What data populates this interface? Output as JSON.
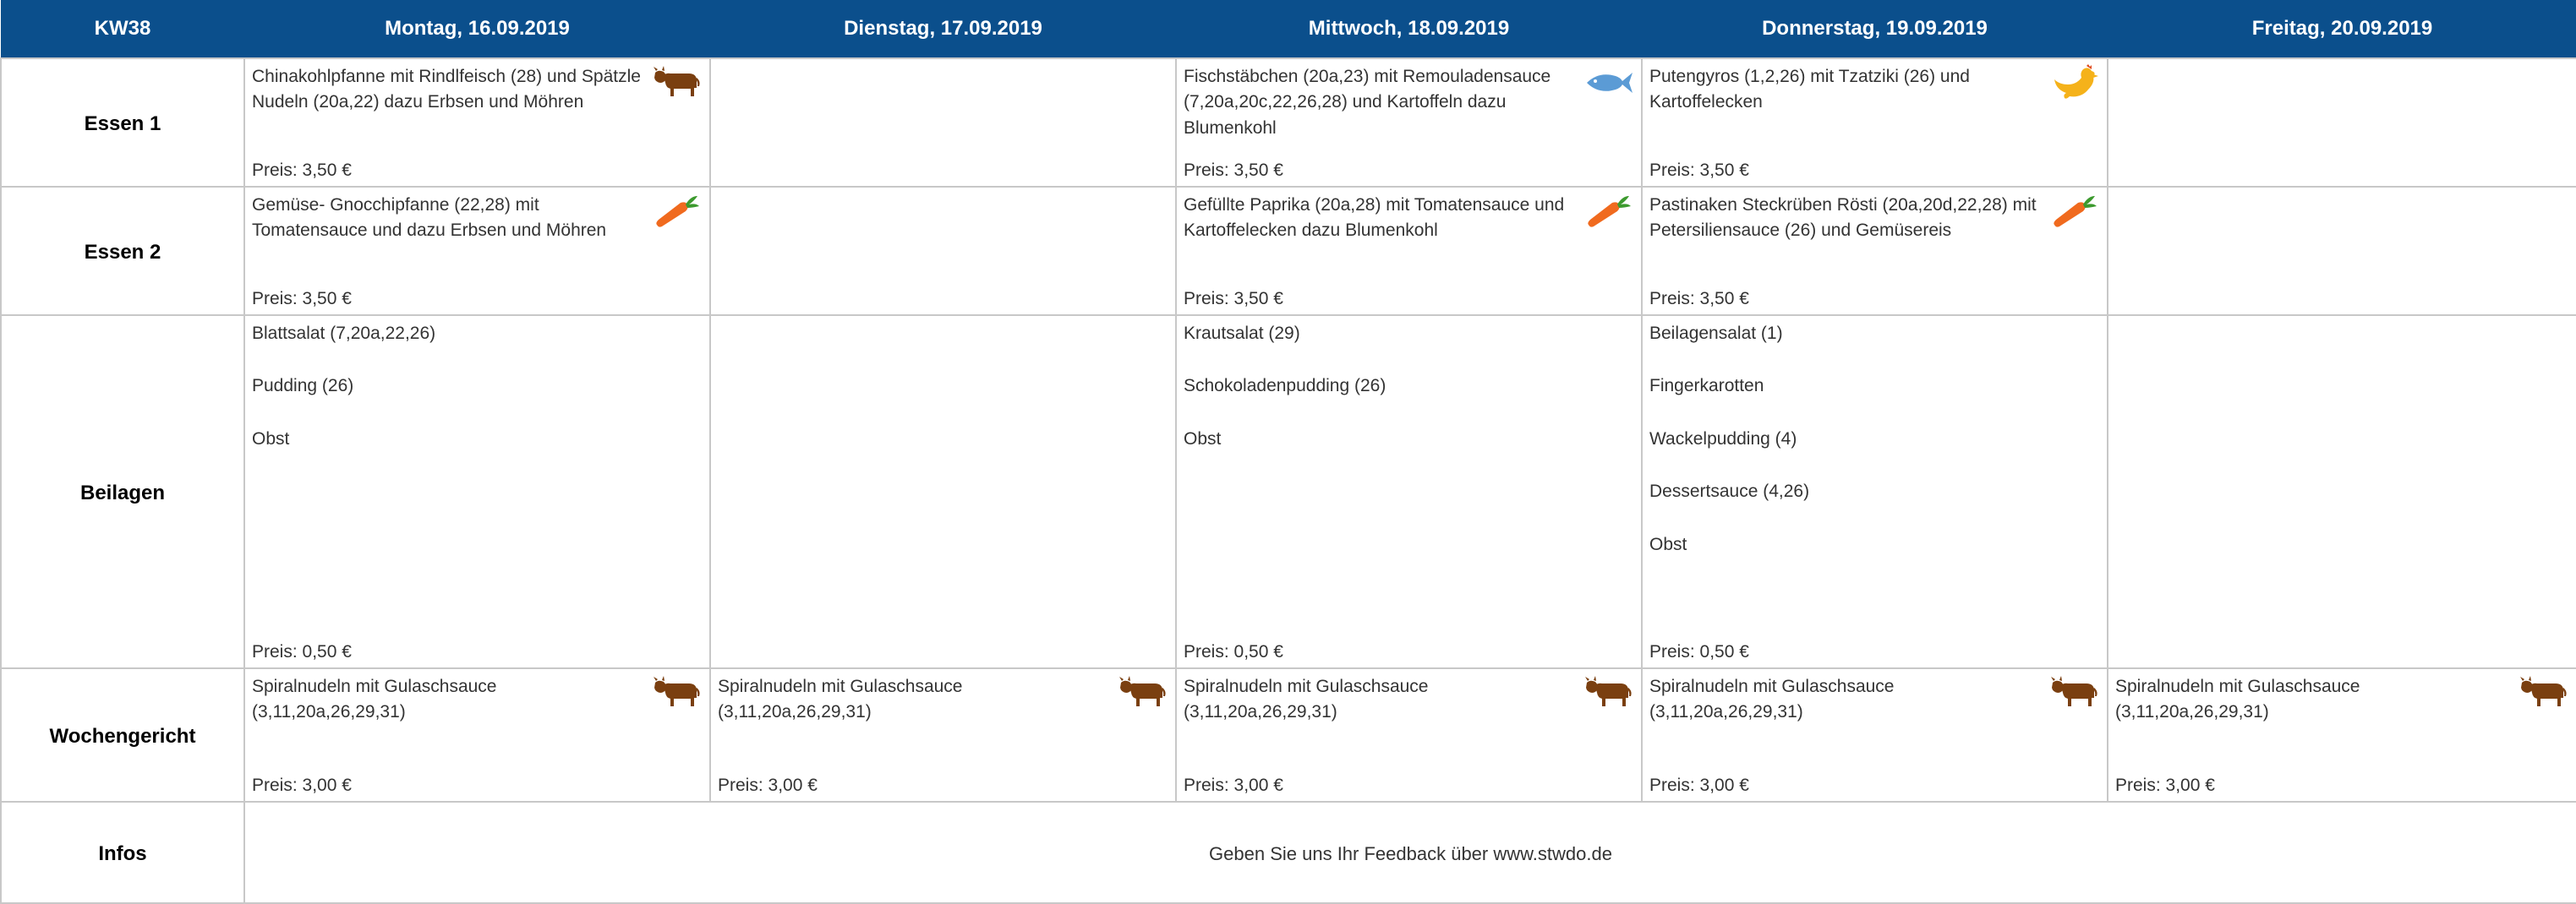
{
  "header": {
    "week": "KW38",
    "days": [
      "Montag, 16.09.2019",
      "Dienstag, 17.09.2019",
      "Mittwoch, 18.09.2019",
      "Donnerstag, 19.09.2019",
      "Freitag, 20.09.2019"
    ]
  },
  "rows": {
    "essen1": {
      "label": "Essen 1",
      "cells": [
        {
          "text": "Chinakohlpfanne mit Rindlfeisch (28) und Spätzle Nudeln (20a,22) dazu Erbsen und Möhren",
          "price": "Preis: 3,50 €",
          "icon": "cow-icon"
        },
        {
          "text": "",
          "price": "",
          "icon": ""
        },
        {
          "text": "Fischstäbchen (20a,23) mit Remouladensauce (7,20a,20c,22,26,28) und Kartoffeln dazu Blumenkohl",
          "price": "Preis: 3,50 €",
          "icon": "fish-icon"
        },
        {
          "text": "Putengyros (1,2,26) mit Tzatziki (26) und Kartoffelecken",
          "price": "Preis: 3,50 €",
          "icon": "chicken-icon"
        },
        {
          "text": "",
          "price": "",
          "icon": ""
        }
      ]
    },
    "essen2": {
      "label": "Essen 2",
      "cells": [
        {
          "text": "Gemüse- Gnocchipfanne (22,28) mit Tomatensauce und dazu Erbsen und Möhren",
          "price": "Preis: 3,50 €",
          "icon": "carrot-icon"
        },
        {
          "text": "",
          "price": "",
          "icon": ""
        },
        {
          "text": "Gefüllte Paprika (20a,28) mit Tomatensauce und Kartoffelecken dazu Blumenkohl",
          "price": "Preis: 3,50 €",
          "icon": "carrot-icon"
        },
        {
          "text": "Pastinaken Steckrüben Rösti (20a,20d,22,28) mit Petersiliensauce (26) und Gemüsereis",
          "price": "Preis: 3,50 €",
          "icon": "carrot-icon"
        },
        {
          "text": "",
          "price": "",
          "icon": ""
        }
      ]
    },
    "beilagen": {
      "label": "Beilagen",
      "cells": [
        {
          "items": [
            "Blattsalat (7,20a,22,26)",
            "Pudding (26)",
            "Obst"
          ],
          "price": "Preis: 0,50 €"
        },
        {
          "items": [],
          "price": ""
        },
        {
          "items": [
            "Krautsalat (29)",
            "Schokoladenpudding (26)",
            "Obst"
          ],
          "price": "Preis: 0,50 €"
        },
        {
          "items": [
            "Beilagensalat  (1)",
            "Fingerkarotten",
            "Wackelpudding (4)",
            "Dessertsauce (4,26)",
            "Obst"
          ],
          "price": "Preis: 0,50 €"
        },
        {
          "items": [],
          "price": ""
        }
      ]
    },
    "wochengericht": {
      "label": "Wochengericht",
      "cells": [
        {
          "text": "Spiralnudeln mit Gulaschsauce (3,11,20a,26,29,31)",
          "price": "Preis: 3,00 €",
          "icon": "cow-icon"
        },
        {
          "text": "Spiralnudeln mit Gulaschsauce (3,11,20a,26,29,31)",
          "price": "Preis: 3,00 €",
          "icon": "cow-icon"
        },
        {
          "text": "Spiralnudeln mit Gulaschsauce (3,11,20a,26,29,31)",
          "price": "Preis: 3,00 €",
          "icon": "cow-icon"
        },
        {
          "text": "Spiralnudeln mit Gulaschsauce (3,11,20a,26,29,31)",
          "price": "Preis: 3,00 €",
          "icon": "cow-icon"
        },
        {
          "text": "Spiralnudeln mit Gulaschsauce (3,11,20a,26,29,31)",
          "price": "Preis: 3,00 €",
          "icon": "cow-icon"
        }
      ]
    },
    "infos": {
      "label": "Infos",
      "text": "Geben Sie uns Ihr Feedback über www.stwdo.de"
    }
  },
  "colors": {
    "header_bg": "#0b4f8c",
    "header_text": "#ffffff",
    "cow": "#7a3f10",
    "fish": "#5b9bd5",
    "chicken": "#f5b21a",
    "carrot": "#f06a1e"
  }
}
